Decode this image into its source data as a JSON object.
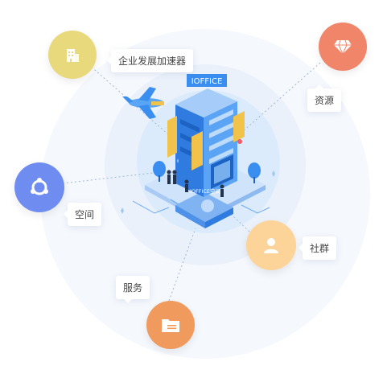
{
  "center": {
    "building_sign": "IOFFICE",
    "base_label": "IOFFICE空间"
  },
  "nodes": [
    {
      "id": "enterprise",
      "label": "企业发展加速器",
      "color": "#e9d97d",
      "icon": "building-icon"
    },
    {
      "id": "resources",
      "label": "资源",
      "color": "#f0856a",
      "icon": "diamond-icon"
    },
    {
      "id": "space",
      "label": "空间",
      "color": "#6f8df0",
      "icon": "network-icon"
    },
    {
      "id": "community",
      "label": "社群",
      "color": "#fcd49a",
      "icon": "user-icon"
    },
    {
      "id": "service",
      "label": "服务",
      "color": "#f09a5e",
      "icon": "folder-icon"
    }
  ],
  "colors": {
    "primary_blue": "#3a8ef0",
    "accent_yellow": "#f2c34b",
    "ring": "#eaf1fb"
  }
}
